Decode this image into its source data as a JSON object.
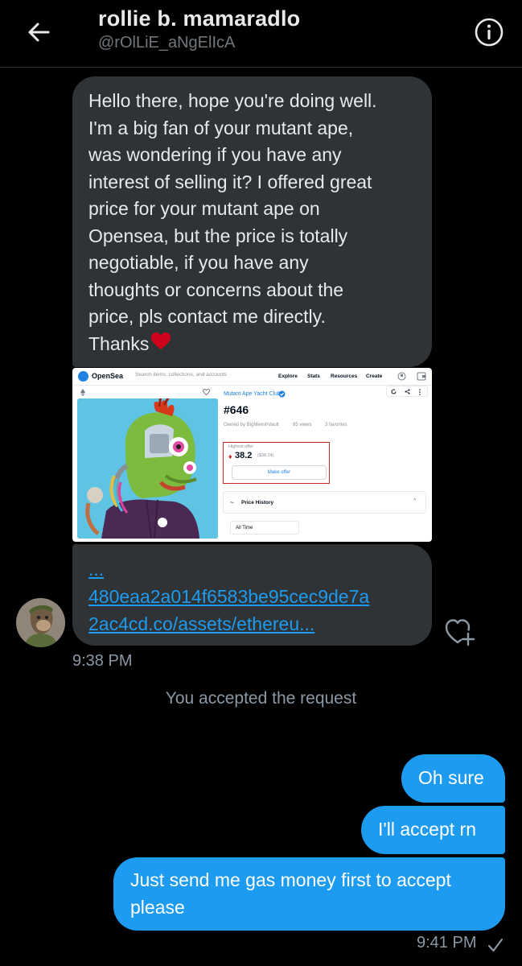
{
  "header": {
    "name": "rollie b. mamaradlo",
    "handle": "@rOlLiE_aNgElIcA"
  },
  "messages": {
    "incoming_text": "Hello there, hope you're doing well.\nI'm a big fan of your mutant ape,\nwas wondering if you have any\ninterest of selling it? I offered great\nprice for your mutant ape on\nOpensea,  but the price is totally\nnegotiable, if you have any\nthoughts or concerns about the\nprice, pls contact me directly.\nThanks",
    "link_lines": [
      "...",
      "480eaa2a014f6583be95cec9de7a",
      "2ac4cd.co/assets/ethereu..."
    ],
    "incoming_time": "9:38 PM",
    "system_notice": "You accepted the request",
    "outgoing": [
      "Oh sure",
      "I'll accept rn",
      "Just send me gas money first to accept please"
    ],
    "outgoing_time": "9:41 PM"
  },
  "opensea_screenshot": {
    "brand": "OpenSea",
    "search_placeholder": "Search items, collections, and accounts",
    "nav": [
      "Explore",
      "Stats",
      "Resources",
      "Create"
    ],
    "collection": "Mutant Ape Yacht Club",
    "token": "#646",
    "owned_by": "Owned by BigMeeshVault",
    "views": "95 views",
    "favorites": "3 favorites",
    "offer_label": "Highest offer",
    "offer_value": "38.2",
    "offer_usd": "($38.24)",
    "make_offer": "Make offer",
    "price_history": "Price History",
    "all_time": "All Time"
  },
  "colors": {
    "background": "#000000",
    "incoming_bubble": "#2f3336",
    "outgoing_bubble": "#1d9bf0",
    "link": "#1d9bf0",
    "muted": "#8b98a5",
    "heart": "#e0245e"
  }
}
